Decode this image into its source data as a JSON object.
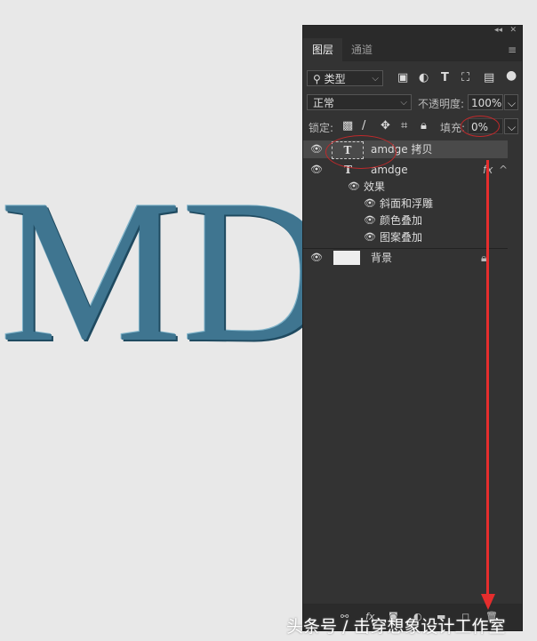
{
  "canvas": {
    "text": "MDG"
  },
  "panel": {
    "tabs": [
      {
        "label": "图层"
      },
      {
        "label": "通道"
      }
    ],
    "filter": {
      "label": "类型"
    },
    "blend_mode": "正常",
    "opacity_label": "不透明度:",
    "opacity_value": "100%",
    "lock_label": "锁定:",
    "fill_label": "填充:",
    "fill_value": "0%",
    "layers": [
      {
        "name": "amdge 拷贝",
        "type": "text"
      },
      {
        "name": "amdge",
        "type": "text",
        "fx": "fx"
      },
      {
        "name": "效果"
      },
      {
        "name": "斜面和浮雕"
      },
      {
        "name": "颜色叠加"
      },
      {
        "name": "图案叠加"
      },
      {
        "name": "背景"
      }
    ]
  },
  "watermark": "头条号 / 击穿想象设计工作室",
  "colors": {
    "annotation": "#e52d2d",
    "panel": "#333333"
  }
}
